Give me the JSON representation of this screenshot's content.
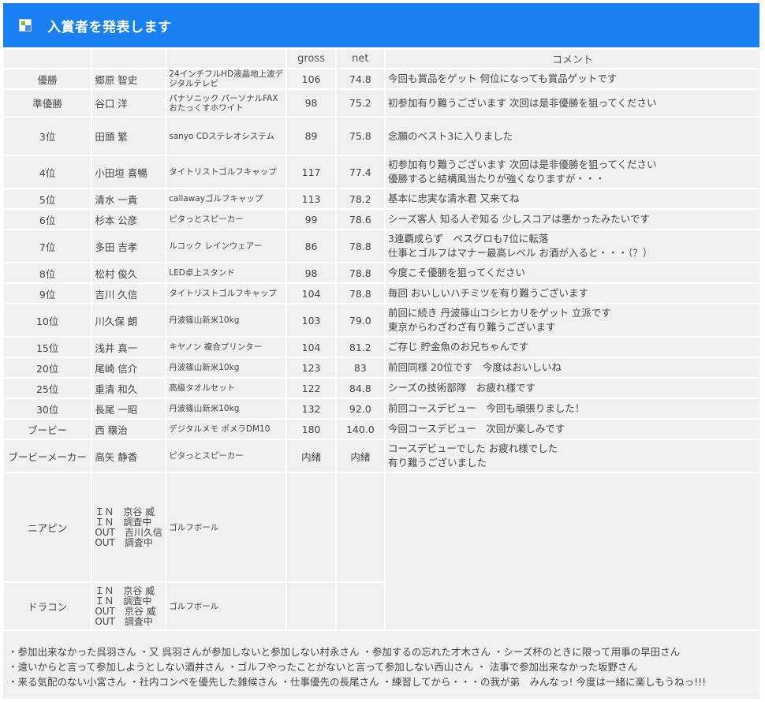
{
  "header": {
    "title": "入賞者を発表します"
  },
  "columns": {
    "rank": "",
    "name": "",
    "prize": "",
    "gross": "gross",
    "net": "net",
    "comment": "コメント"
  },
  "rows": [
    {
      "rank": "優勝",
      "name": "郷原 智史",
      "prize": "24インチフルHD液晶地上波デジタルテレビ",
      "gross": "106",
      "net": "74.8",
      "comment": "今回も賞品をゲット 何位になっても賞品ゲットです"
    },
    {
      "rank": "準優勝",
      "name": "谷口 洋",
      "prize": "パナソニック パーソナルFAX おたっくすホワイト",
      "gross": "98",
      "net": "75.2",
      "comment": "初参加有り難うございます 次回は是非優勝を狙ってください"
    },
    {
      "rank": "3位",
      "name": "田頭 繁",
      "prize": "sanyo CDステレオシステム",
      "gross": "89",
      "net": "75.8",
      "comment": "念願のベスト3に入りました"
    },
    {
      "rank": "4位",
      "name": "小田垣 喜暢",
      "prize": "タイトリストゴルフキャップ",
      "gross": "117",
      "net": "77.4",
      "comment": "初参加有り難うございます 次回は是非優勝を狙ってください\n優勝すると結構風当たりが強くなりますが・・・"
    },
    {
      "rank": "5位",
      "name": "清水 一貴",
      "prize": "callawayゴルフキャップ",
      "gross": "113",
      "net": "78.2",
      "comment": "基本に忠実な清水君 又来てね"
    },
    {
      "rank": "6位",
      "name": "杉本 公彦",
      "prize": "ピタっとスピーカー",
      "gross": "99",
      "net": "78.6",
      "comment": "シーズ客人 知る人ぞ知る 少しスコアは悪かったみたいです"
    },
    {
      "rank": "7位",
      "name": "多田 吉孝",
      "prize": "ルコック レインウェアー",
      "gross": "86",
      "net": "78.8",
      "comment": "3連覇成らず　ベスグロも7位に転落\n仕事とゴルフはマナー最高レベル お酒が入ると・・・（？）"
    },
    {
      "rank": "8位",
      "name": "松村 俊久",
      "prize": "LED卓上スタンド",
      "gross": "98",
      "net": "78.8",
      "comment": "今度こそ優勝を狙ってください"
    },
    {
      "rank": "9位",
      "name": "吉川 久信",
      "prize": "タイトリストゴルフキャップ",
      "gross": "104",
      "net": "78.8",
      "comment": "毎回 おいしいハチミツを有り難うございます"
    },
    {
      "rank": "10位",
      "name": "川久保 朗",
      "prize": "丹波篠山新米10kg",
      "gross": "103",
      "net": "79.0",
      "comment": "前回に続き 丹波篠山コシヒカリをゲット 立派です\n東京からわざわざ有り難うございます"
    },
    {
      "rank": "15位",
      "name": "浅井 真一",
      "prize": "キヤノン 複合プリンター",
      "gross": "104",
      "net": "81.2",
      "comment": "ご存じ 貯金魚のお兄ちゃんです"
    },
    {
      "rank": "20位",
      "name": "尾崎 信介",
      "prize": "丹波篠山新米10kg",
      "gross": "123",
      "net": "83",
      "comment": "前回同様 20位です　今度はおいしいね"
    },
    {
      "rank": "25位",
      "name": "重清 和久",
      "prize": "高級タオルセット",
      "gross": "122",
      "net": "84.8",
      "comment": "シーズの技術部隊　お疲れ様です"
    },
    {
      "rank": "30位",
      "name": "長尾 一昭",
      "prize": "丹波篠山新米10kg",
      "gross": "132",
      "net": "92.0",
      "comment": "前回コースデビュー　今回も頑張りました！"
    },
    {
      "rank": "ブービー",
      "name": "西 穣治",
      "prize": "デジタルメモ ポメラDM10",
      "gross": "180",
      "net": "140.0",
      "comment": "今回コースデビュー　次回が楽しみです"
    },
    {
      "rank": "ブービーメーカー",
      "name": "高矢 静香",
      "prize": "ピタっとスピーカー",
      "gross": "内緒",
      "net": "内緒",
      "comment": "コースデビューでした お疲れ様でした\n有り難うございました"
    }
  ],
  "special": [
    {
      "rank": "ニアピン",
      "name": "ＩＮ　京谷 威\nＩＮ　調査中\nOUT　吉川久信\nOUT　調査中",
      "prize": "ゴルフボール"
    },
    {
      "rank": "ドラコン",
      "name": "ＩＮ　京谷 威\nＩＮ　調査中\nOUT　京谷 威\nOUT　調査中",
      "prize": "ゴルフボール"
    }
  ],
  "footer": {
    "lines": [
      "・参加出来なかった呉羽さん ・又 呉羽さんが参加しないと参加しない村永さん ・参加するの忘れた才木さん ・シーズ杯のときに限って用事の早田さん",
      "・遠いからと言って参加しようとしない酒井さん ・ゴルフやったことがないと言って参加しない西山さん ・ 法事で参加出来なかった坂野さん",
      "・来る気配のない小宮さん ・社内コンペを優先した雑候さん ・仕事優先の長尾さん ・練習してから・・・の我が弟　みんなっ! 今度は一緒に楽しもうねっ!!!"
    ]
  }
}
